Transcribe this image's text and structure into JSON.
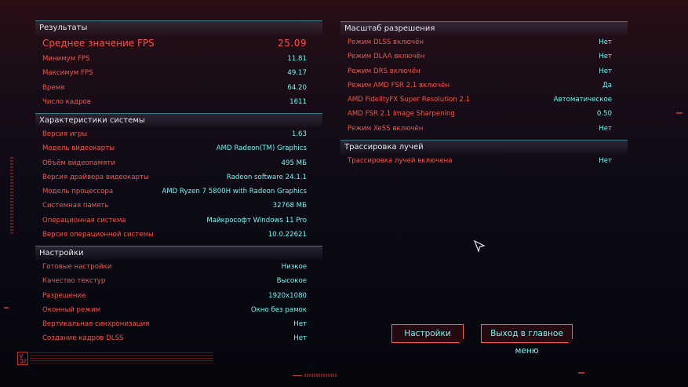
{
  "results": {
    "header": "Результаты",
    "avg_fps": {
      "label": "Среднее значение FPS",
      "value": "25.09"
    },
    "rows": [
      {
        "label": "Минимум FPS",
        "value": "11.81"
      },
      {
        "label": "Максимум FPS",
        "value": "49.17"
      },
      {
        "label": "Время",
        "value": "64.20"
      },
      {
        "label": "Число кадров",
        "value": "1611"
      }
    ]
  },
  "system": {
    "header": "Характеристики системы",
    "rows": [
      {
        "label": "Версия игры",
        "value": "1.63"
      },
      {
        "label": "Модель видеокарты",
        "value": "AMD Radeon(TM) Graphics"
      },
      {
        "label": "Объём видеопамяти",
        "value": "495 МБ"
      },
      {
        "label": "Версия драйвера видеокарты",
        "value": "Radeon software 24.1.1"
      },
      {
        "label": "Модель процессора",
        "value": "AMD Ryzen 7 5800H with Radeon Graphics"
      },
      {
        "label": "Системная память",
        "value": "32768 МБ"
      },
      {
        "label": "Операционная система",
        "value": "Майкрософт Windows 11 Pro"
      },
      {
        "label": "Версия операционной системы",
        "value": "10.0.22621"
      }
    ]
  },
  "settings": {
    "header": "Настройки",
    "rows": [
      {
        "label": "Готовые настройки",
        "value": "Низкое"
      },
      {
        "label": "Качество текстур",
        "value": "Высокое"
      },
      {
        "label": "Разрешение",
        "value": "1920x1080"
      },
      {
        "label": "Оконный режим",
        "value": "Окно без рамок"
      },
      {
        "label": "Вертикальная синхронизация",
        "value": "Нет"
      },
      {
        "label": "Создание кадров DLSS",
        "value": "Нет"
      }
    ]
  },
  "scaling": {
    "header": "Масштаб разрешения",
    "rows": [
      {
        "label": "Режим DLSS включён",
        "value": "Нет"
      },
      {
        "label": "Режим DLAA включён",
        "value": "Нет"
      },
      {
        "label": "Режим DRS включён",
        "value": "Нет"
      },
      {
        "label": "Режим AMD FSR 2.1 включён",
        "value": "Да"
      },
      {
        "label": "AMD FidelityFX Super Resolution 2.1",
        "value": "Автоматическое"
      },
      {
        "label": "AMD FSR 2.1 Image Sharpening",
        "value": "0.50"
      },
      {
        "label": "Режим XeSS включён",
        "value": "Нет"
      }
    ]
  },
  "raytracing": {
    "header": "Трассировка лучей",
    "rows": [
      {
        "label": "Трассировка лучей включена",
        "value": "Нет"
      }
    ]
  },
  "buttons": {
    "settings": "Настройки",
    "main_menu": "Выход в главное меню"
  },
  "icons": {
    "cursor": "cursor-arrow-icon",
    "logo": "studio-logo-icon"
  },
  "colors": {
    "label": "#f0564d",
    "value": "#6ef3ee",
    "accent_line": "#5ad2dc",
    "button_border": "#ff5c55"
  }
}
